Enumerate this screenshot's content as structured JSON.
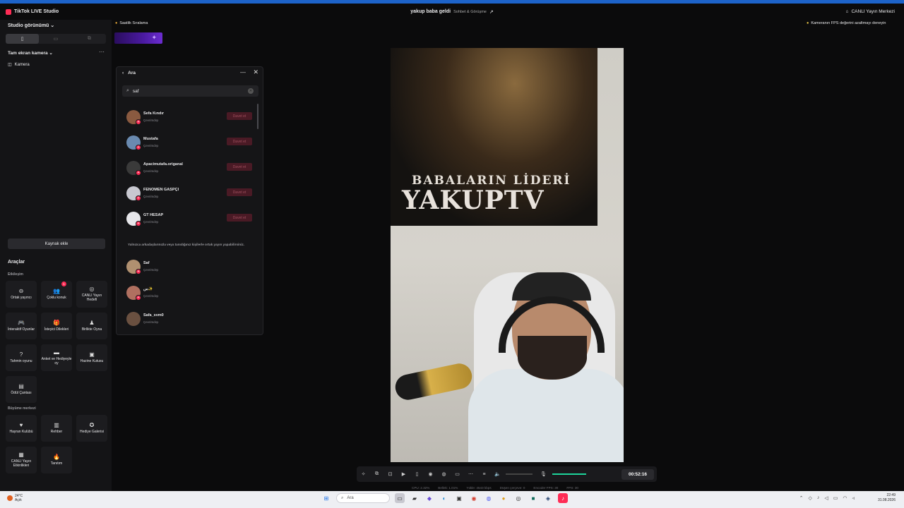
{
  "app": {
    "title": "TikTok LIVE Studio",
    "stream_title": "yakup baba geldi",
    "stream_category": "Sohbet & Görüşme",
    "live_center": "CANLI Yayın Merkezi"
  },
  "sidebar": {
    "studio_view": "Studio görünümü",
    "scene_name": "Tam ekran kamera",
    "more": "⋯",
    "source_camera": "Kamera",
    "add_source": "Kaynak ekle",
    "tools_title": "Araçlar",
    "sections": {
      "interaction": "Etkileşim",
      "growth": "Büyüme merkezi"
    },
    "tools": [
      {
        "label": "Ortak yayıncı",
        "icon": "co-host-icon"
      },
      {
        "label": "Çoklu konuk",
        "icon": "multi-guest-icon",
        "badge": "1"
      },
      {
        "label": "CANLI Yayın Hedefi",
        "icon": "goal-icon"
      },
      {
        "label": "İnteraktif Oyunlar",
        "icon": "gamepad-icon"
      },
      {
        "label": "İsteyici Dilekleri",
        "icon": "gift-icon"
      },
      {
        "label": "Birlikte Oyna",
        "icon": "play-together-icon"
      },
      {
        "label": "Tahmin oyunu",
        "icon": "prediction-icon"
      },
      {
        "label": "Anket ve Hediyeyle oy",
        "icon": "poll-icon"
      },
      {
        "label": "Hazine Kutusu",
        "icon": "treasure-icon"
      },
      {
        "label": "Ödül Çantası",
        "icon": "reward-bag-icon"
      }
    ],
    "growth_tools": [
      {
        "label": "Hayran Kulübü",
        "icon": "fan-club-icon"
      },
      {
        "label": "Rehber",
        "icon": "guide-icon"
      },
      {
        "label": "Hediye Galerisi",
        "icon": "gift-gallery-icon"
      },
      {
        "label": "CANLI Yayın Etkinlikleri",
        "icon": "events-icon"
      },
      {
        "label": "Tanıtım",
        "icon": "promote-icon"
      }
    ]
  },
  "gift_ranking": "Saatlik Sıralama",
  "fps_tip": "Kameranın FPS değerini azaltmayı deneyin",
  "search_panel": {
    "title": "Ara",
    "query": "saf",
    "invite_label": "Davet et",
    "status_label": "Çevrimdışı",
    "note": "Yalnızca arkadaşlarınızla veya tanıdığınız kişilerle ortak yayın yapabilirsiniz.",
    "friends": [
      {
        "name": "Sefa Kındır",
        "avatar_color": "#8a5a40"
      },
      {
        "name": "Mustafa",
        "avatar_color": "#6a8ab0"
      },
      {
        "name": "Apacimutafa.origanal",
        "avatar_color": "#3a3a3a"
      },
      {
        "name": "FENOMEN GASPÇI",
        "avatar_color": "#c8c8d0"
      },
      {
        "name": "GT HESAP",
        "avatar_color": "#e6e6ea"
      }
    ],
    "others": [
      {
        "name": "Saf",
        "avatar_color": "#b09070"
      },
      {
        "name": "س✨",
        "avatar_color": "#b07060"
      },
      {
        "name": "Safa_svm0",
        "avatar_color": "#6a5040"
      }
    ]
  },
  "video": {
    "poster_line1": "BABALARIN LİDERİ",
    "poster_line2": "YAKUPTV"
  },
  "controls": {
    "timer": "00:52:16",
    "mic_level": 0.9,
    "volume_level": 0.0
  },
  "stats": {
    "cpu": "CPU: 2.32%",
    "bitrate": "Bellek: 1.01%",
    "upload": "Yükle: 4543 kbps",
    "dropped": "Düşen çerçeve: 0",
    "encoder_fps": "Encoder FPS: 30",
    "fps": "FPS: 30"
  },
  "taskbar": {
    "temp": "24°C",
    "weather": "Açık",
    "search": "Ara",
    "time": "22:49",
    "date": "31.08.2026"
  }
}
